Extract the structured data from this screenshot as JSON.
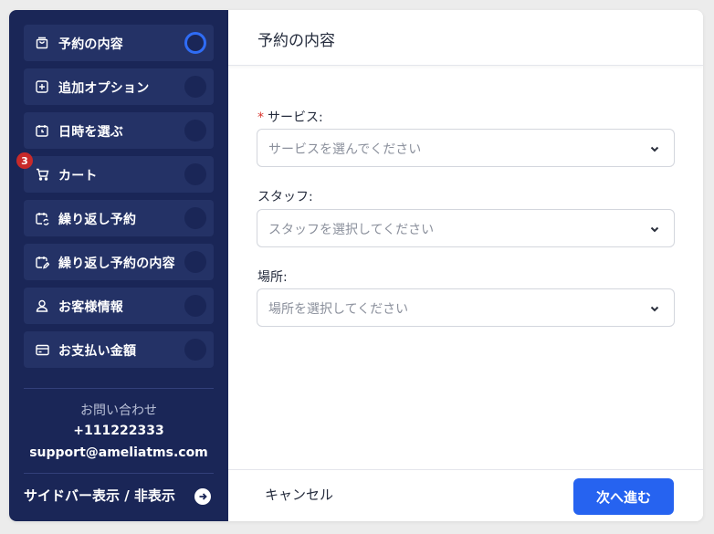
{
  "sidebar": {
    "items": [
      {
        "label": "予約の内容",
        "icon": "shopping-bag-icon",
        "active": true
      },
      {
        "label": "追加オプション",
        "icon": "plus-square-icon",
        "active": false
      },
      {
        "label": "日時を選ぶ",
        "icon": "calendar-clock-icon",
        "active": false
      },
      {
        "label": "カート",
        "icon": "cart-icon",
        "active": false
      },
      {
        "label": "繰り返し予約",
        "icon": "calendar-repeat-icon",
        "active": false
      },
      {
        "label": "繰り返し予約の内容",
        "icon": "calendar-edit-icon",
        "active": false
      },
      {
        "label": "お客様情報",
        "icon": "user-icon",
        "active": false
      },
      {
        "label": "お支払い金額",
        "icon": "credit-card-icon",
        "active": false
      }
    ],
    "cart_badge": "3",
    "contact": {
      "title": "お問い合わせ",
      "phone": "+111222333",
      "email": "support@ameliatms.com"
    },
    "toggle_label": "サイドバー表示 / 非表示"
  },
  "main": {
    "title": "予約の内容",
    "fields": {
      "service": {
        "label": "サービス:",
        "required_mark": "*",
        "placeholder": "サービスを選んでください"
      },
      "staff": {
        "label": "スタッフ:",
        "placeholder": "スタッフを選択してください"
      },
      "location": {
        "label": "場所:",
        "placeholder": "場所を選択してください"
      }
    }
  },
  "footer": {
    "cancel_label": "キャンセル",
    "next_label": "次へ進む"
  },
  "colors": {
    "sidebar_bg": "#1a2657",
    "nav_item_bg": "#243266",
    "accent": "#2663f0",
    "active_ring": "#2f6cf5",
    "badge": "#c82a2a",
    "required": "#d8342c"
  }
}
